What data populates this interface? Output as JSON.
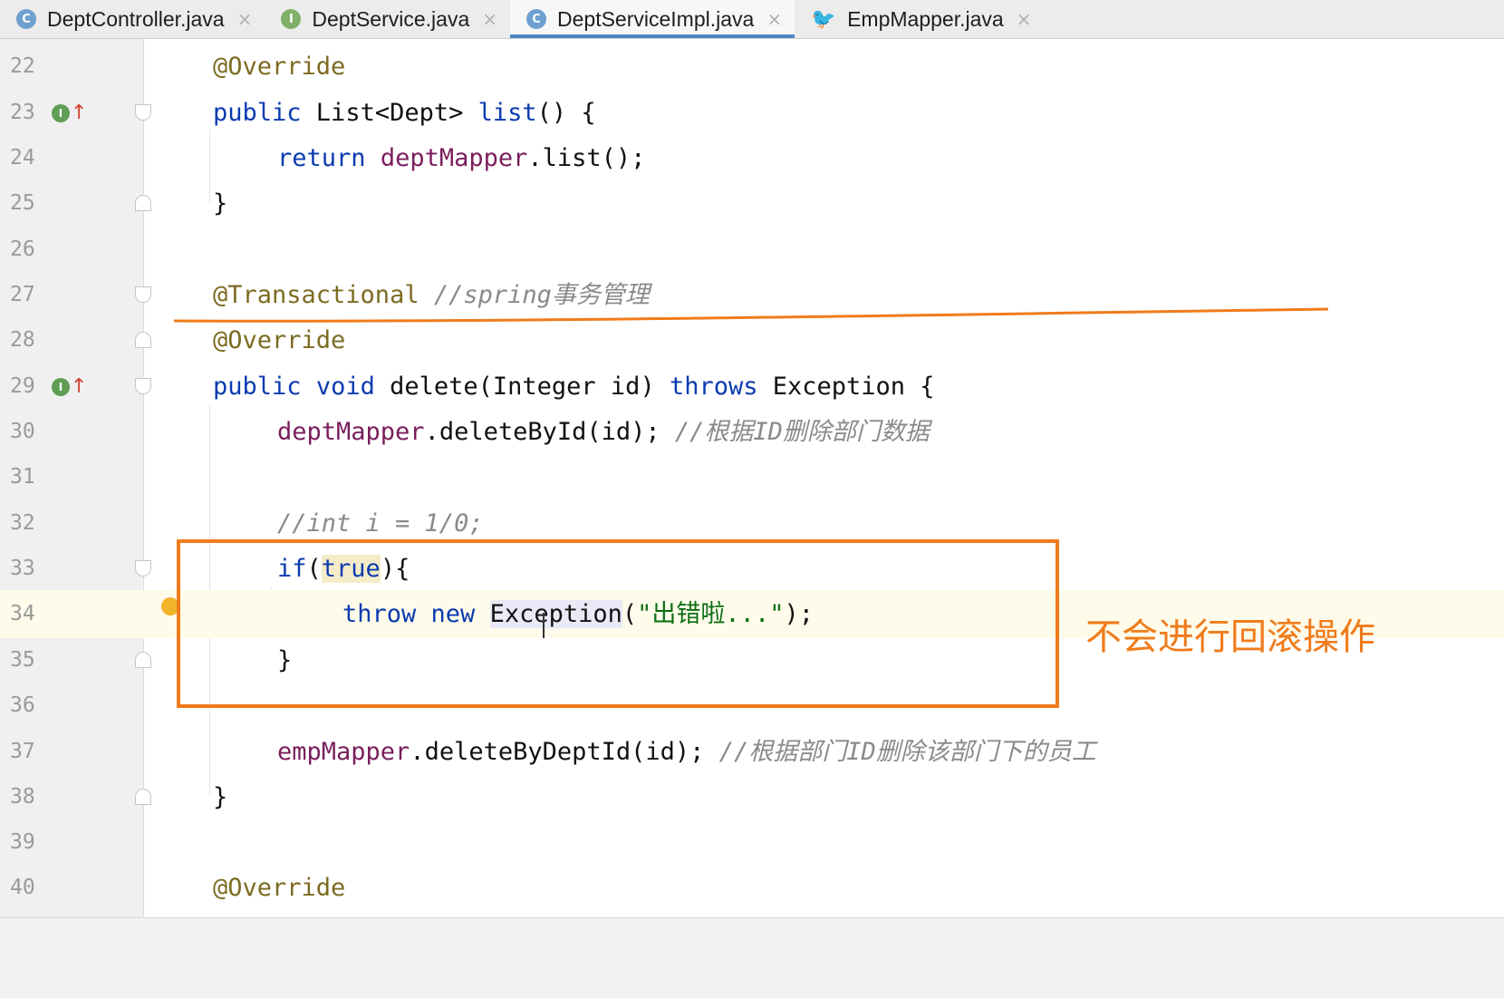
{
  "tabs": [
    {
      "label": "DeptController.java",
      "icon": "class-icon",
      "icon_glyph": "C",
      "active": false
    },
    {
      "label": "DeptService.java",
      "icon": "interface-icon",
      "icon_glyph": "I",
      "active": false
    },
    {
      "label": "DeptServiceImpl.java",
      "icon": "class-icon",
      "icon_glyph": "C",
      "active": true
    },
    {
      "label": "EmpMapper.java",
      "icon": "mapper-icon",
      "icon_glyph": "🐦",
      "active": false
    }
  ],
  "close_glyph": "×",
  "editor": {
    "current_line": "34",
    "lines": [
      {
        "num": "22"
      },
      {
        "num": "23"
      },
      {
        "num": "24"
      },
      {
        "num": "25"
      },
      {
        "num": "26"
      },
      {
        "num": "27"
      },
      {
        "num": "28"
      },
      {
        "num": "29"
      },
      {
        "num": "30"
      },
      {
        "num": "31"
      },
      {
        "num": "32"
      },
      {
        "num": "33"
      },
      {
        "num": "34"
      },
      {
        "num": "35"
      },
      {
        "num": "36"
      },
      {
        "num": "37"
      },
      {
        "num": "38"
      },
      {
        "num": "39"
      },
      {
        "num": "40"
      }
    ],
    "tokens": {
      "l22": [
        "@Override"
      ],
      "l23": [
        "public",
        " List<Dept> ",
        "list",
        "() {"
      ],
      "l24": [
        "return",
        " ",
        "deptMapper",
        ".list();"
      ],
      "l25": [
        "}"
      ],
      "l27": [
        "@Transactional",
        " ",
        "//spring事务管理"
      ],
      "l28": [
        "@Override"
      ],
      "l29": [
        "public",
        " ",
        "void",
        " delete(Integer id) ",
        "throws",
        " Exception {"
      ],
      "l30": [
        "deptMapper",
        ".deleteById(id); ",
        "//根据ID删除部门数据"
      ],
      "l32": [
        "//int i = 1/0;"
      ],
      "l33": [
        "if",
        "(",
        "true",
        "){"
      ],
      "l34": [
        "throw",
        " ",
        "new",
        " ",
        "Exception",
        "(",
        "\"出错啦...\"",
        ");"
      ],
      "l35": [
        "}"
      ],
      "l37": [
        "empMapper",
        ".deleteByDeptId(id); ",
        "//根据部门ID删除该部门下的员工"
      ],
      "l38": [
        "}"
      ],
      "l40": [
        "@Override"
      ]
    },
    "override_badge": "I",
    "override_arrow": "↑"
  },
  "annotation": {
    "callout_text": "不会进行回滚操作",
    "color": "#f07b1b"
  }
}
